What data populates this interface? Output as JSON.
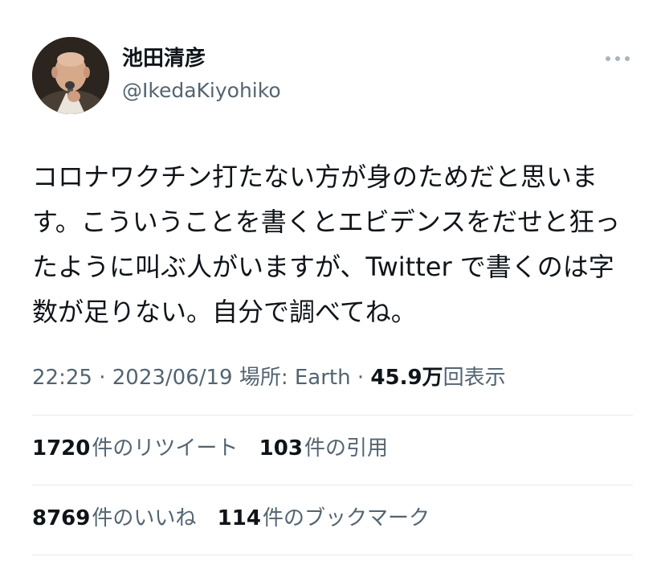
{
  "author": {
    "display_name": "池田清彦",
    "handle": "@IkedaKiyohiko",
    "avatar_icon": "profile-photo"
  },
  "more_icon": "ellipsis-icon",
  "tweet": {
    "text": "コロナワクチン打たない方が身のためだと思います。こういうことを書くとエビデンスをだせと狂ったように叫ぶ人がいますが、Twitter で書くのは字数が足りない。自分で調べてね。"
  },
  "meta": {
    "time": "22:25",
    "sep1": " · ",
    "date": "2023/06/19",
    "location_label": " 場所: Earth",
    "sep2": " · ",
    "views_count": "45.9万",
    "views_label": "回表示"
  },
  "stats": {
    "retweets_count": "1720",
    "retweets_label": "件のリツイート",
    "quotes_count": "103",
    "quotes_label": "件の引用",
    "likes_count": "8769",
    "likes_label": "件のいいね",
    "bookmarks_count": "114",
    "bookmarks_label": "件のブックマーク"
  },
  "colors": {
    "text": "#0f1419",
    "secondary": "#536471",
    "divider": "#e6e9eb"
  }
}
